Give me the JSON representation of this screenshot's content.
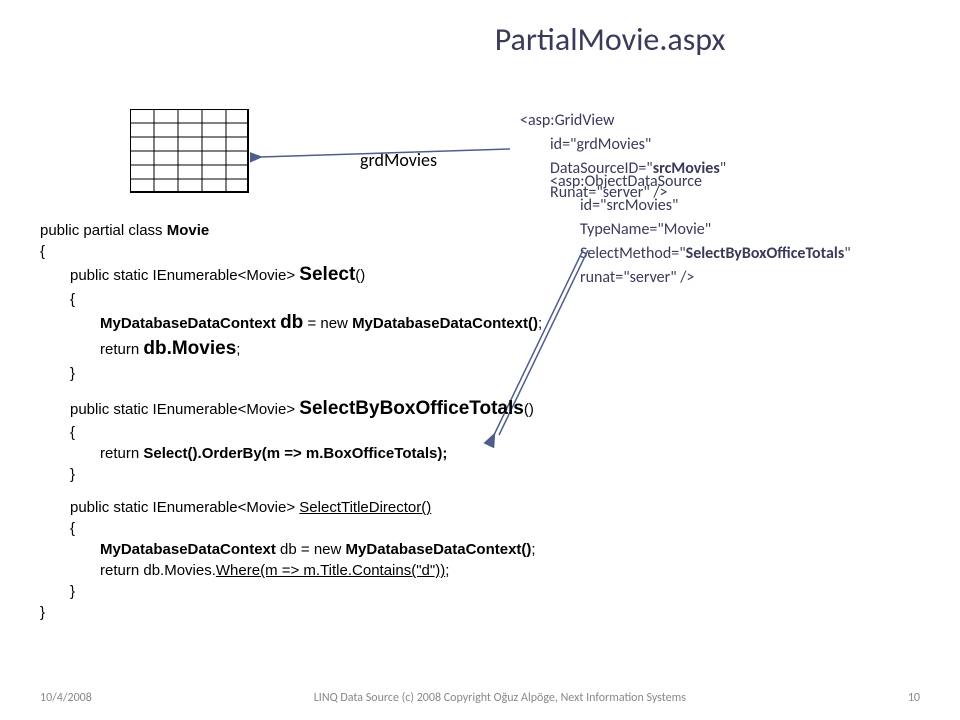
{
  "title": "PartialMovie.aspx",
  "grdLabel": "grdMovies",
  "gridview": {
    "tag": "<asp:GridView",
    "id": "id=\"grdMovies\"",
    "ds": "DataSourceID=\"",
    "dsBold": "srcMovies",
    "dsEnd": "\"",
    "runat": "Runat=\"server\" />"
  },
  "ods": {
    "tag": "<asp:ObjectDataSource",
    "id": "id=\"srcMovies\"",
    "typename": "TypeName=\"Movie\"",
    "selmethod": "SelectMethod=\"",
    "selmethodBold": "SelectByBoxOfficeTotals",
    "selmethodEnd": "\"",
    "runat": "runat=\"server\" />"
  },
  "code": {
    "l1a": "public partial class ",
    "l1b": "Movie",
    "l2": "{",
    "l3a": "public static IEnumerable<Movie> ",
    "l3b": "Select",
    "l3c": "()",
    "l4": "{",
    "l5a": "MyDatabaseDataContext ",
    "l5b": "db",
    "l5c": " = new ",
    "l5d": "MyDatabaseDataContext()",
    "l5e": ";",
    "l6a": "return ",
    "l6b": "db.Movies",
    "l6c": ";",
    "l7": "}",
    "l8a": "public static IEnumerable<Movie> ",
    "l8b": "SelectByBoxOfficeTotals",
    "l8c": "()",
    "l9": "{",
    "l10a": "return ",
    "l10b": "Select().OrderBy(m => m.BoxOfficeTotals);",
    "l11": "}",
    "l12a": "public static IEnumerable<Movie> ",
    "l12b": "SelectTitleDirector()",
    "l13": "{",
    "l14a": "MyDatabaseDataContext",
    "l14b": " db = new ",
    "l14c": "MyDatabaseDataContext()",
    "l14d": ";",
    "l15a": "return db.Movies.",
    "l15b": "Where(m => m.Title.Contains(\"d\"))",
    "l15c": ";",
    "l16": "}",
    "l17": "}"
  },
  "footer": {
    "date": "10/4/2008",
    "center": "LINQ Data Source (c) 2008 Copyright Oğuz Alpöge, Next Information Systems",
    "page": "10"
  }
}
